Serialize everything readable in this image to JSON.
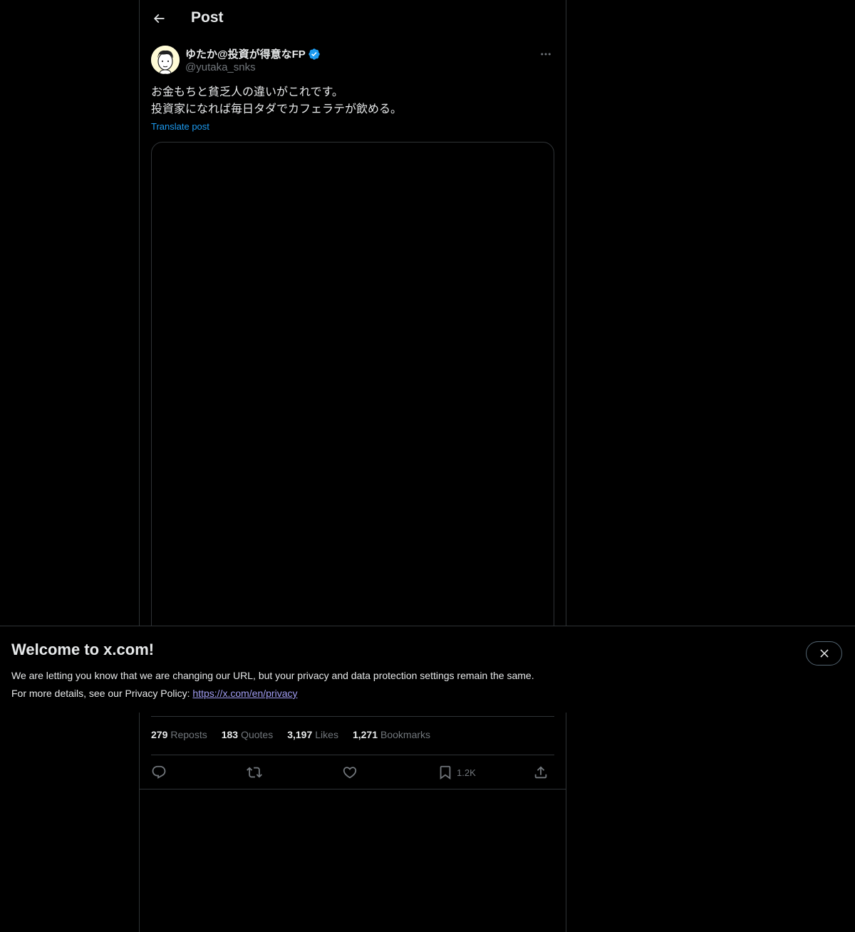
{
  "header": {
    "title": "Post"
  },
  "post": {
    "author_name": "ゆたか@投資が得意なFP",
    "author_handle": "@yutaka_snks",
    "text_lines": [
      "お金もちと貧乏人の違いがこれです。",
      "投資家になれば毎日タダでカフェラテが飲める。"
    ],
    "translate_label": "Translate post"
  },
  "stats": {
    "reposts": {
      "count": "279",
      "label": "Reposts"
    },
    "quotes": {
      "count": "183",
      "label": "Quotes"
    },
    "likes": {
      "count": "3,197",
      "label": "Likes"
    },
    "bookmarks": {
      "count": "1,271",
      "label": "Bookmarks"
    }
  },
  "actions": {
    "bookmark_count": "1.2K",
    "icons": [
      "reply-icon",
      "repost-icon",
      "like-icon",
      "bookmark-icon",
      "share-icon"
    ]
  },
  "banner": {
    "title": "Welcome to x.com!",
    "line1": "We are letting you know that we are changing our URL, but your privacy and data protection settings remain the same.",
    "line2_prefix": "For more details, see our Privacy Policy: ",
    "link_text": "https://x.com/en/privacy"
  },
  "colors": {
    "background": "#000000",
    "text": "#e7e9ea",
    "muted": "#71767b",
    "accent": "#1d9bf0",
    "border": "#2f3336",
    "link_visited": "#a09cf2"
  }
}
